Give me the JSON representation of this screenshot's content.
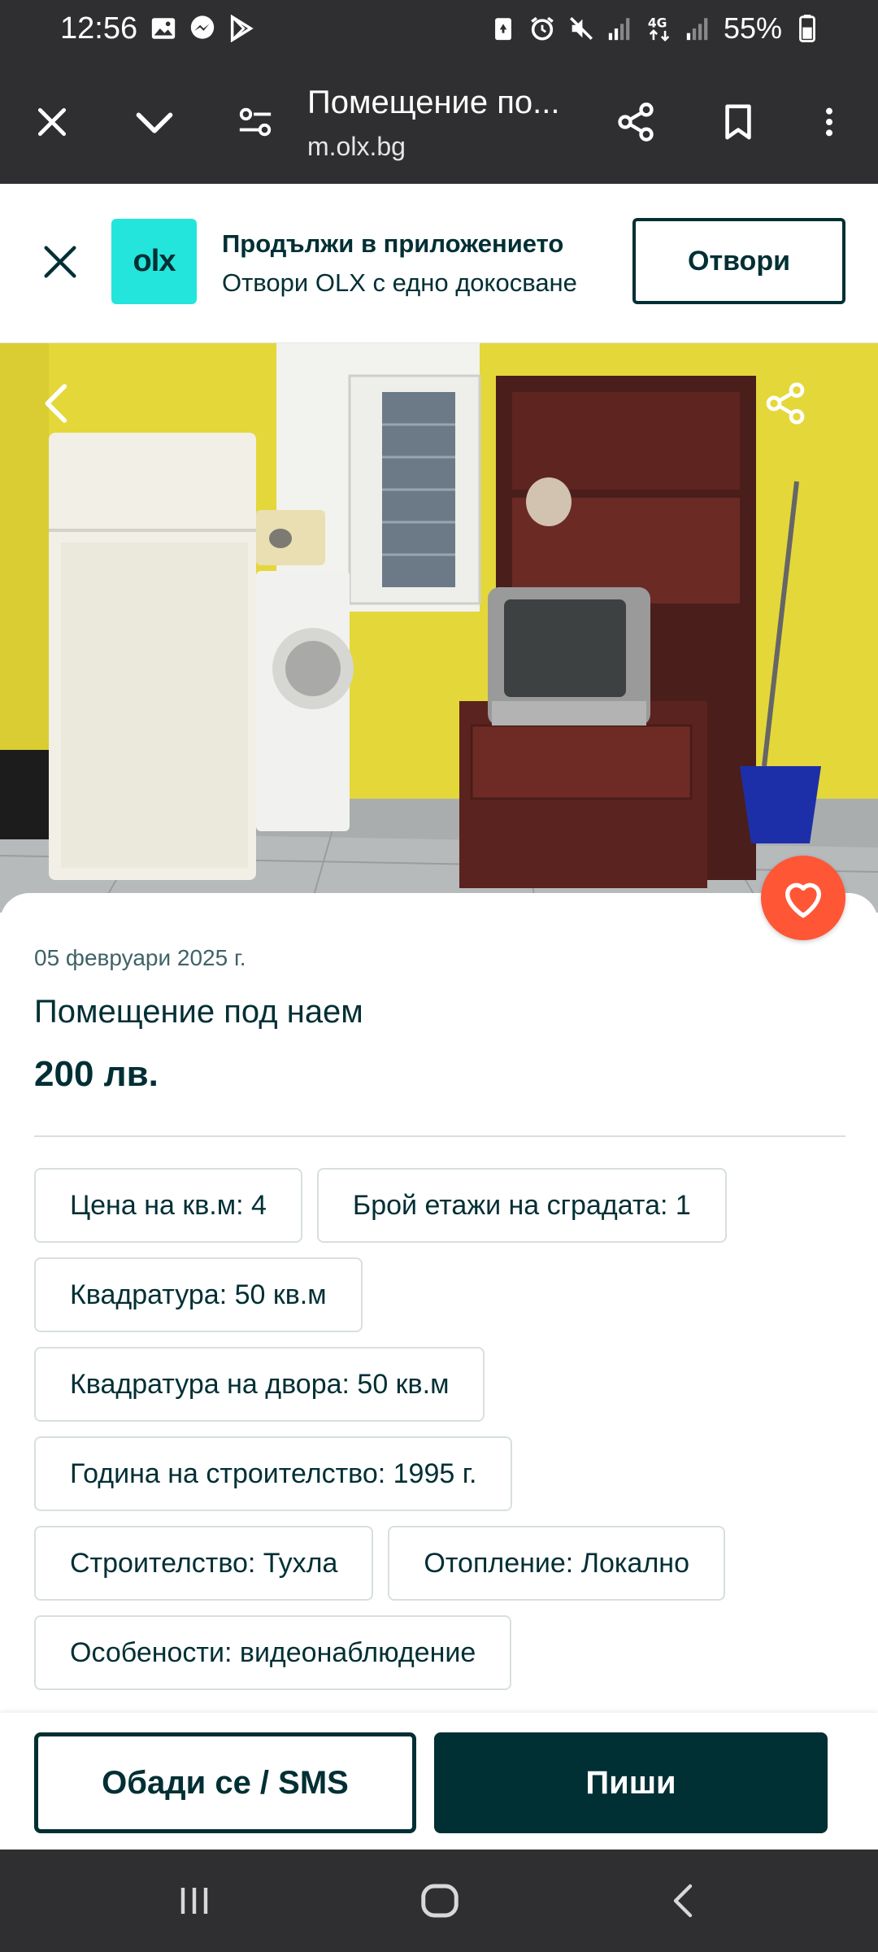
{
  "status_bar": {
    "time": "12:56",
    "battery": "55%",
    "icons_left": [
      "gallery-icon",
      "messenger-icon",
      "play-store-icon"
    ],
    "icons_right": [
      "battery-saver-icon",
      "alarm-icon",
      "mute-icon",
      "signal-icon",
      "4g-icon",
      "signal-icon",
      "battery-icon"
    ]
  },
  "browser": {
    "page_title": "Помещение по...",
    "url": "m.olx.bg"
  },
  "app_banner": {
    "logo_text": "olx",
    "title": "Продължи в приложението",
    "subtitle": "Отвори OLX с едно докосване",
    "open_label": "Отвори"
  },
  "listing": {
    "date": "05 февруари 2025 г.",
    "title": "Помещение под наем",
    "price": "200 лв.",
    "attributes": [
      [
        "Цена на кв.м: 4",
        "Брой етажи на сградата: 1"
      ],
      [
        "Квадратура: 50 кв.м"
      ],
      [
        "Квадратура на двора: 50 кв.м"
      ],
      [
        "Година на строителство: 1995 г."
      ],
      [
        "Строителство: Тухла",
        "Отопление: Локално"
      ],
      [
        "Особености: видеонаблюдение"
      ]
    ]
  },
  "actions": {
    "call_label": "Обади се / SMS",
    "write_label": "Пиши"
  },
  "colors": {
    "brand_dark": "#002f34",
    "brand_teal": "#23e5db",
    "favorite": "#ff5636",
    "chrome": "#2f2f31"
  }
}
